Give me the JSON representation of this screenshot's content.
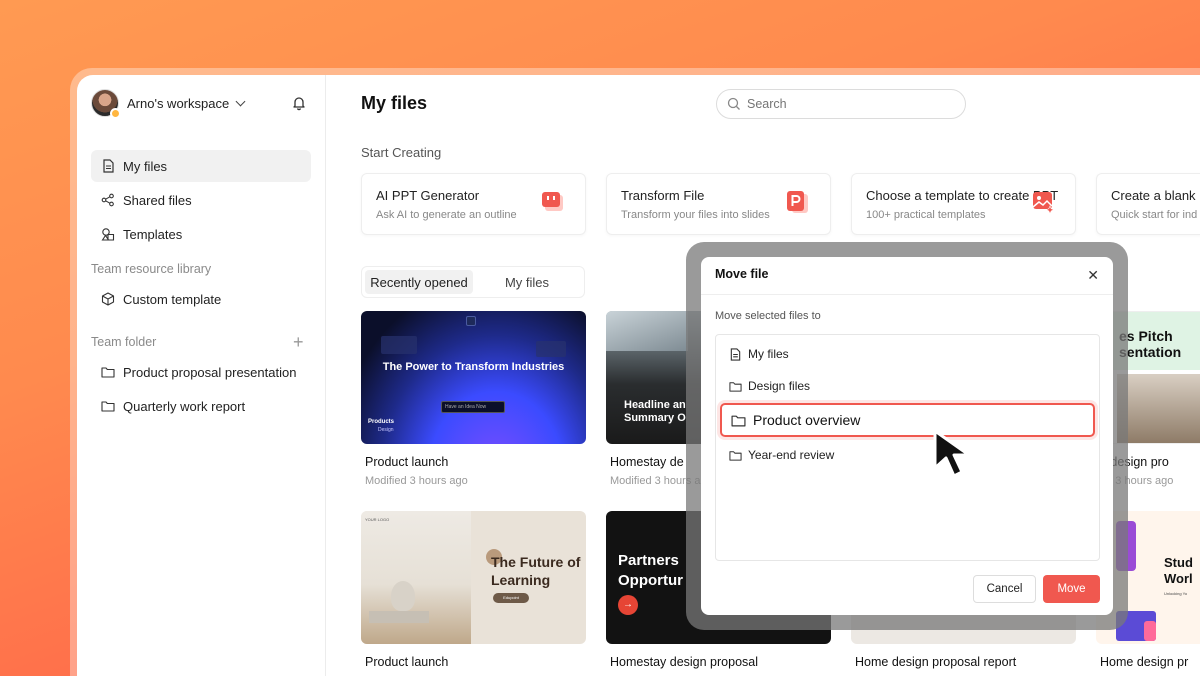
{
  "workspace": {
    "name": "Arno's workspace"
  },
  "sidebar": {
    "nav": [
      {
        "label": "My files",
        "icon": "file-icon",
        "active": true
      },
      {
        "label": "Shared files",
        "icon": "share-icon",
        "active": false
      },
      {
        "label": "Templates",
        "icon": "templates-icon",
        "active": false
      }
    ],
    "team_resource_label": "Team resource library",
    "custom_template": "Custom template",
    "team_folder_label": "Team folder",
    "folders": [
      "Product proposal presentation",
      "Quarterly work report"
    ]
  },
  "main": {
    "title": "My files",
    "search_placeholder": "Search",
    "start_creating": "Start Creating",
    "cards": [
      {
        "title": "AI PPT Generator",
        "subtitle": "Ask AI to generate an outline"
      },
      {
        "title": "Transform File",
        "subtitle": "Transform your files into slides"
      },
      {
        "title": "Choose a template to create PPT",
        "subtitle": "100+ practical templates"
      },
      {
        "title": "Create a blank",
        "subtitle": "Quick start for ind"
      }
    ],
    "tabs": [
      "Recently opened",
      "My files"
    ],
    "files_row1": [
      {
        "name": "Product launch",
        "meta": "Modified 3 hours ago",
        "thumb_title": "The Power to Transform Industries",
        "thumb_input": "Have an Idea Now",
        "thumb_brand": "Products",
        "thumb_brand2": "Design"
      },
      {
        "name": "Homestay de",
        "meta": "Modified 3 hours ago",
        "thumb_title": "Headline an Summary O"
      },
      {
        "name": "",
        "meta": ""
      },
      {
        "name": "e design pro",
        "meta": "ed 3 hours ago",
        "thumb_title": "es Pitch sentation"
      }
    ],
    "files_row2": [
      {
        "name": "Product launch",
        "thumb_title": "The Future of Learning",
        "thumb_tag": "Edupoint",
        "thumb_logo": "YOUR LOGO"
      },
      {
        "name": "Homestay design proposal",
        "thumb_title": "Partners Opportur"
      },
      {
        "name": "Home design proposal report"
      },
      {
        "name": "Home design pr",
        "thumb_title": "Stud Worl",
        "thumb_sub": "Unlocking Yo"
      }
    ]
  },
  "dialog": {
    "title": "Move file",
    "label": "Move selected files to",
    "items": [
      {
        "label": "My files",
        "icon": "file-icon"
      },
      {
        "label": "Design files",
        "icon": "folder-icon"
      },
      {
        "label": "Product overview",
        "icon": "folder-icon",
        "selected": true
      },
      {
        "label": "Year-end review",
        "icon": "folder-icon"
      }
    ],
    "cancel": "Cancel",
    "move": "Move"
  },
  "colors": {
    "accent": "#f0584f",
    "sidebar_active": "#f1f1f1"
  }
}
